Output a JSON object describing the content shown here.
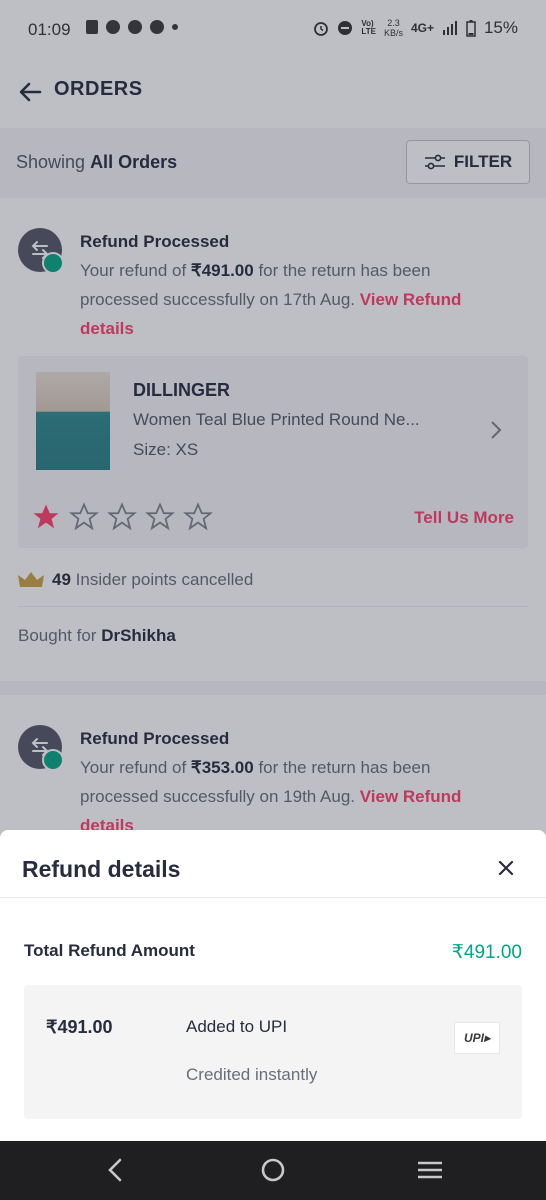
{
  "status_bar": {
    "time": "01:09",
    "net_speed_top": "2.3",
    "net_speed_bottom": "KB/s",
    "network": "4G+",
    "battery": "15%"
  },
  "app_bar": {
    "title": "ORDERS"
  },
  "filter_bar": {
    "showing_prefix": "Showing",
    "showing_value": "All Orders",
    "filter_label": "FILTER"
  },
  "orders": [
    {
      "status_title": "Refund Processed",
      "desc_pre": "Your refund of ",
      "amount": "₹491.00",
      "desc_post": " for the return has been processed successfully on 17th Aug. ",
      "link": "View Refund details",
      "brand": "DILLINGER",
      "product_name": "Women Teal Blue Printed Round Ne...",
      "size": "Size: XS",
      "rating": 1,
      "tell_more": "Tell Us More",
      "insider_points": "49",
      "insider_text": "Insider points cancelled",
      "bought_for_label": "Bought for",
      "bought_for_name": "DrShikha"
    },
    {
      "status_title": "Refund Processed",
      "desc_pre": "Your refund of ",
      "amount": "₹353.00",
      "desc_post": " for the return has been processed successfully on 19th Aug. ",
      "link": "View Refund details"
    }
  ],
  "sheet": {
    "title": "Refund details",
    "total_label": "Total Refund Amount",
    "total_value": "₹491.00",
    "entry_amount": "₹491.00",
    "entry_mode": "Added to UPI",
    "entry_status": "Credited instantly",
    "upi_logo_text": "UPI"
  },
  "colors": {
    "accent_pink": "#ff3f6c",
    "success_green": "#03a685",
    "text_dark": "#282c3f"
  }
}
